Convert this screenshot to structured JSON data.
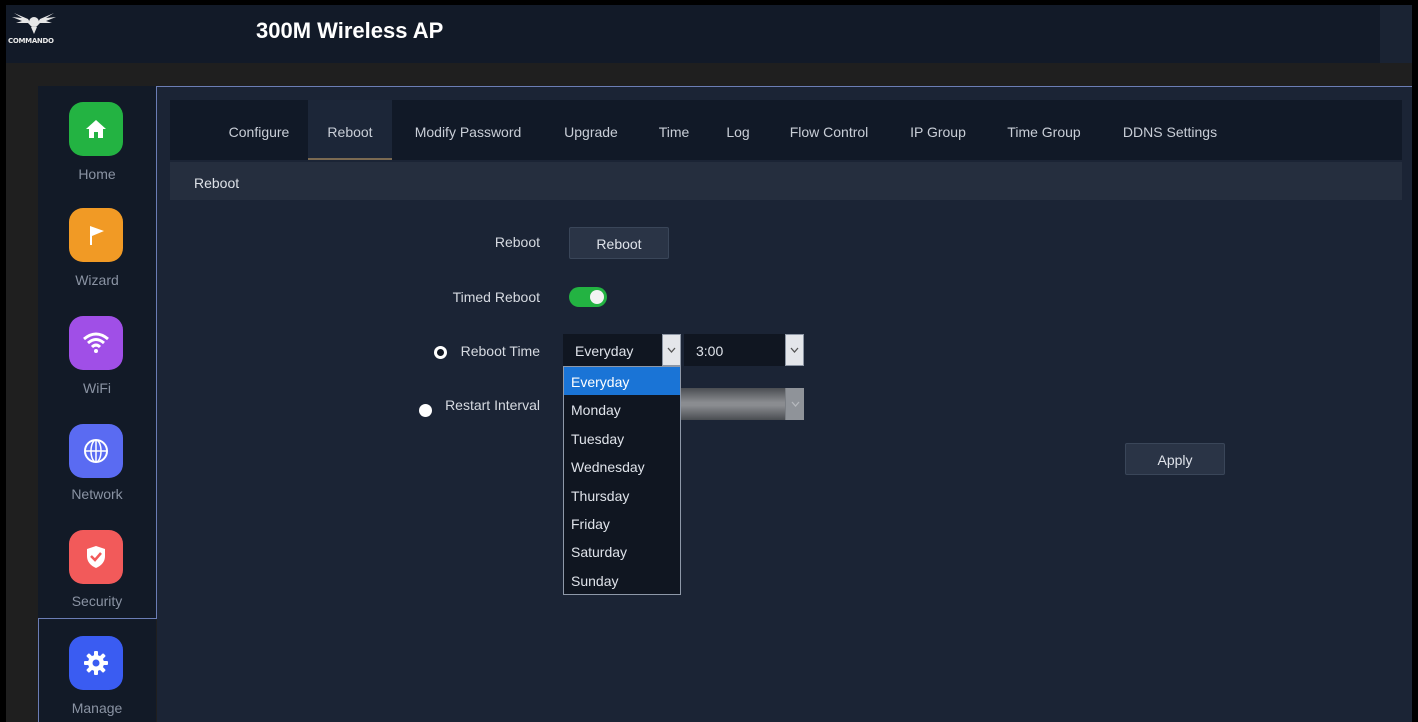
{
  "brand": {
    "logo_text": "COMMANDO",
    "title": "300M Wireless AP"
  },
  "sidebar": {
    "items": [
      {
        "label": "Home",
        "icon": "home-icon",
        "color": "#23b342"
      },
      {
        "label": "Wizard",
        "icon": "flag-icon",
        "color": "#f19a25"
      },
      {
        "label": "WiFi",
        "icon": "wifi-icon",
        "color": "#a04fe7"
      },
      {
        "label": "Network",
        "icon": "globe-icon",
        "color": "#5a6bf2"
      },
      {
        "label": "Security",
        "icon": "shield-icon",
        "color": "#f25a5a"
      },
      {
        "label": "Manage",
        "icon": "gear-icon",
        "color": "#3a5cf2",
        "active": true
      }
    ]
  },
  "tabs": [
    "Configure",
    "Reboot",
    "Modify Password",
    "Upgrade",
    "Time",
    "Log",
    "Flow Control",
    "IP Group",
    "Time Group",
    "DDNS Settings"
  ],
  "active_tab": "Reboot",
  "section_title": "Reboot",
  "form": {
    "reboot_label": "Reboot",
    "reboot_button": "Reboot",
    "timed_reboot_label": "Timed Reboot",
    "timed_reboot_on": true,
    "reboot_time_label": "Reboot Time",
    "reboot_day_value": "Everyday",
    "reboot_hour_value": "3:00",
    "restart_interval_label": "Restart Interval",
    "apply_button": "Apply"
  },
  "dropdown": {
    "options": [
      "Everyday",
      "Monday",
      "Tuesday",
      "Wednesday",
      "Thursday",
      "Friday",
      "Saturday",
      "Sunday"
    ],
    "selected": "Everyday"
  },
  "colors": {
    "accent_green": "#23b342",
    "selected_option": "#1a74d6"
  }
}
